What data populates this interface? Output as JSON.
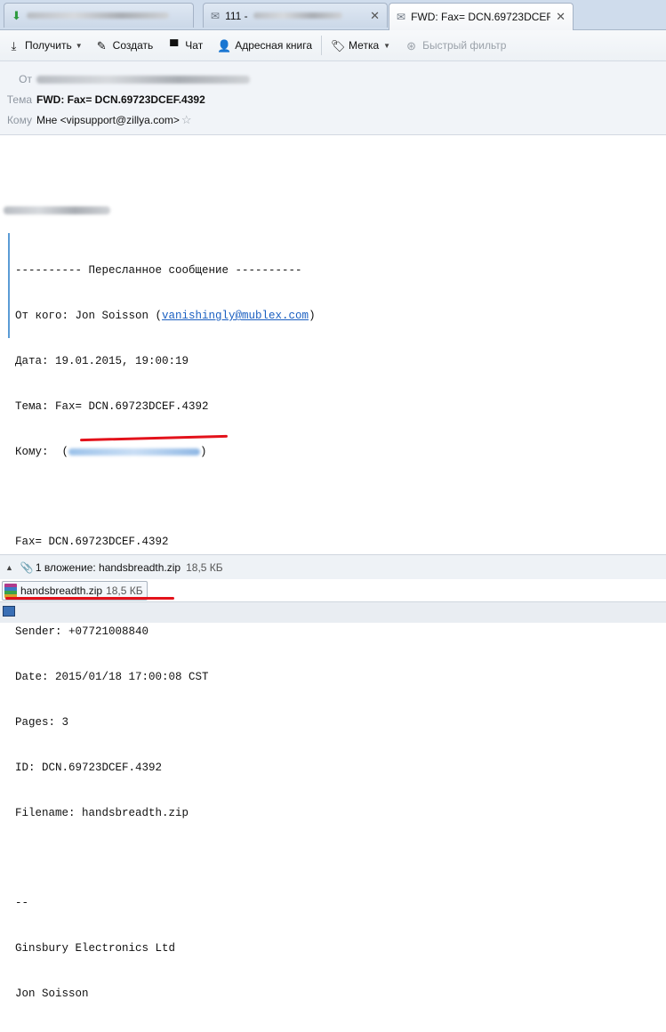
{
  "tabs": [
    {
      "title": ""
    },
    {
      "title": "111 - "
    },
    {
      "title": "FWD: Fax= DCN.69723DCEF.4392"
    }
  ],
  "toolbar": {
    "get": "Получить",
    "compose": "Создать",
    "chat": "Чат",
    "addressbook": "Адресная книга",
    "tag": "Метка",
    "quickfilter": "Быстрый фильтр"
  },
  "header": {
    "from_label": "От",
    "subject_label": "Тема",
    "subject": "FWD: Fax= DCN.69723DCEF.4392",
    "to_label": "Кому",
    "to": "Мне <vipsupport@zillya.com>"
  },
  "message": {
    "fwd_line": "---------- Пересланное сообщение ----------",
    "from_prefix": "От кого: Jon Soisson (",
    "from_email": "vanishingly@mublex.com",
    "from_suffix": ")",
    "date": "Дата: 19.01.2015, 19:00:19",
    "subject": "Тема: Fax= DCN.69723DCEF.4392",
    "to_prefix": "Кому:  (",
    "to_suffix": ")",
    "fax_line": "Fax= DCN.69723DCEF.4392",
    "sender": "Sender: +07721008840",
    "date2": "Date: 2015/01/18 17:00:08 CST",
    "pages": "Pages: 3",
    "id": "ID: DCN.69723DCEF.4392",
    "filename_prefix": "Filename: ",
    "filename": "handsbreadth.zip",
    "sig_sep": "--",
    "company": "Ginsbury Electronics Ltd",
    "name": "Jon Soisson"
  },
  "attachments": {
    "summary": "1 вложение: handsbreadth.zip",
    "summary_size": "18,5 КБ",
    "items": [
      {
        "name": "handsbreadth.zip",
        "size": "18,5 КБ"
      }
    ]
  },
  "colors": {
    "accent": "#5b9bd5",
    "link": "#1a5fc1",
    "highlight": "#e3121b"
  }
}
